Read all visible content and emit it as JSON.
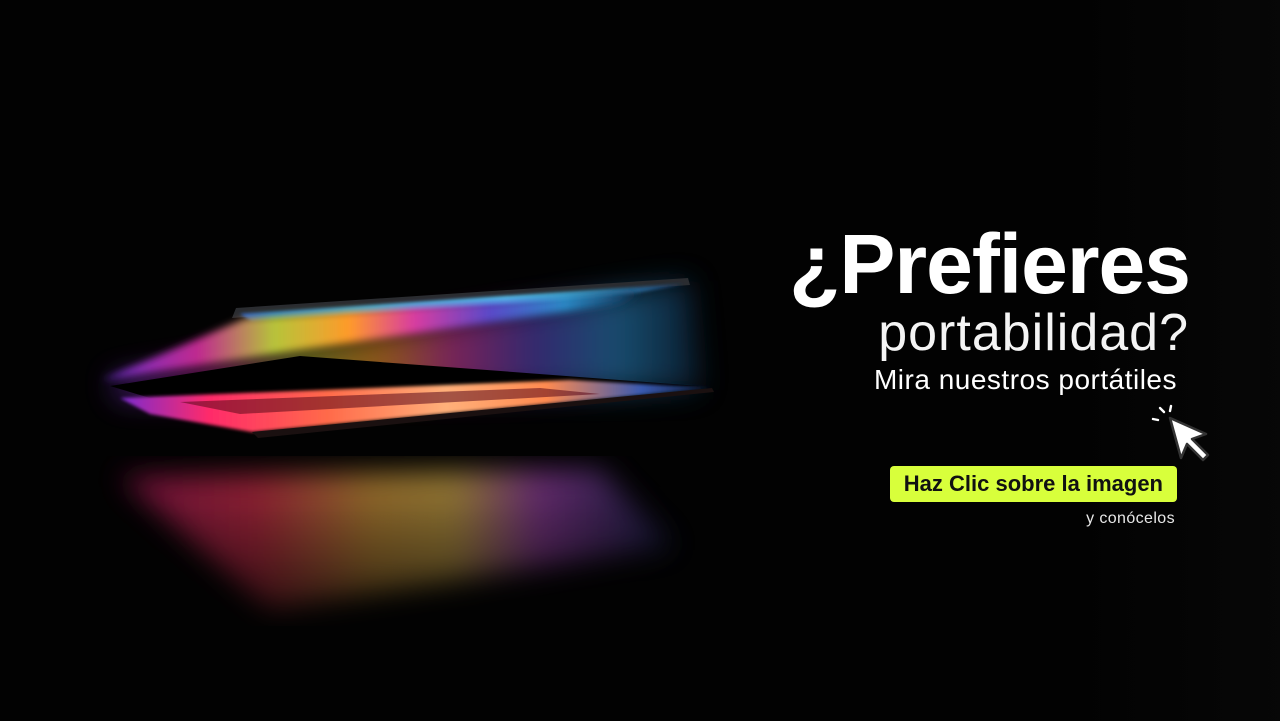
{
  "banner": {
    "headline": "¿Prefieres",
    "subheadline": "portabilidad?",
    "tagline": "Mira nuestros portátiles",
    "cta_label": "Haz Clic sobre la imagen",
    "cta_sub": "y conócelos"
  },
  "icons": {
    "pointer": "hand-cursor-icon",
    "laptop": "laptop-image"
  },
  "colors": {
    "background": "#020202",
    "cta_background": "#d8ff3b",
    "cta_text": "#111111",
    "text": "#ffffff"
  }
}
